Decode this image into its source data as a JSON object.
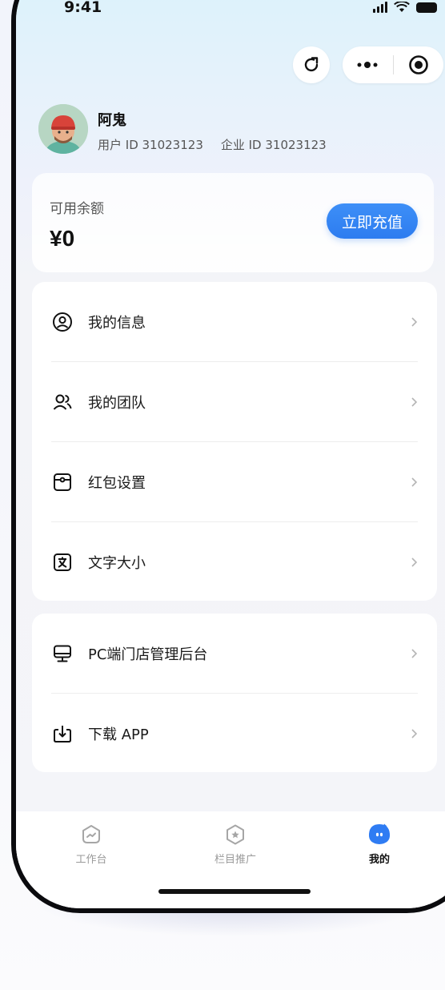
{
  "status_bar": {
    "time": "9:41"
  },
  "header": {
    "refresh_icon": "rotate-arrow-icon",
    "more_icon": "more-dots-icon",
    "target_icon": "target-circle-icon"
  },
  "profile": {
    "name": "阿鬼",
    "user_id": "用户 ID 31023123",
    "company_id": "企业 ID 31023123"
  },
  "balance": {
    "label": "可用余额",
    "amount": "¥0",
    "recharge_label": "立即充值"
  },
  "menu_group_1": [
    {
      "label": "我的信息",
      "icon": "user-circle-icon"
    },
    {
      "label": "我的团队",
      "icon": "team-icon"
    },
    {
      "label": "红包设置",
      "icon": "red-packet-icon"
    },
    {
      "label": "文字大小",
      "icon": "text-size-icon"
    }
  ],
  "menu_group_2": [
    {
      "label": "PC端门店管理后台",
      "icon": "monitor-icon"
    },
    {
      "label": "下载 APP",
      "icon": "download-icon"
    }
  ],
  "tabbar": {
    "tabs": [
      {
        "label": "工作台",
        "icon": "workbench-icon",
        "active": false
      },
      {
        "label": "栏目推广",
        "icon": "promotion-icon",
        "active": false
      },
      {
        "label": "我的",
        "icon": "mine-icon",
        "active": true
      }
    ]
  },
  "colors": {
    "accent": "#2d7cf0",
    "text_primary": "#111111",
    "text_secondary": "#555555"
  }
}
